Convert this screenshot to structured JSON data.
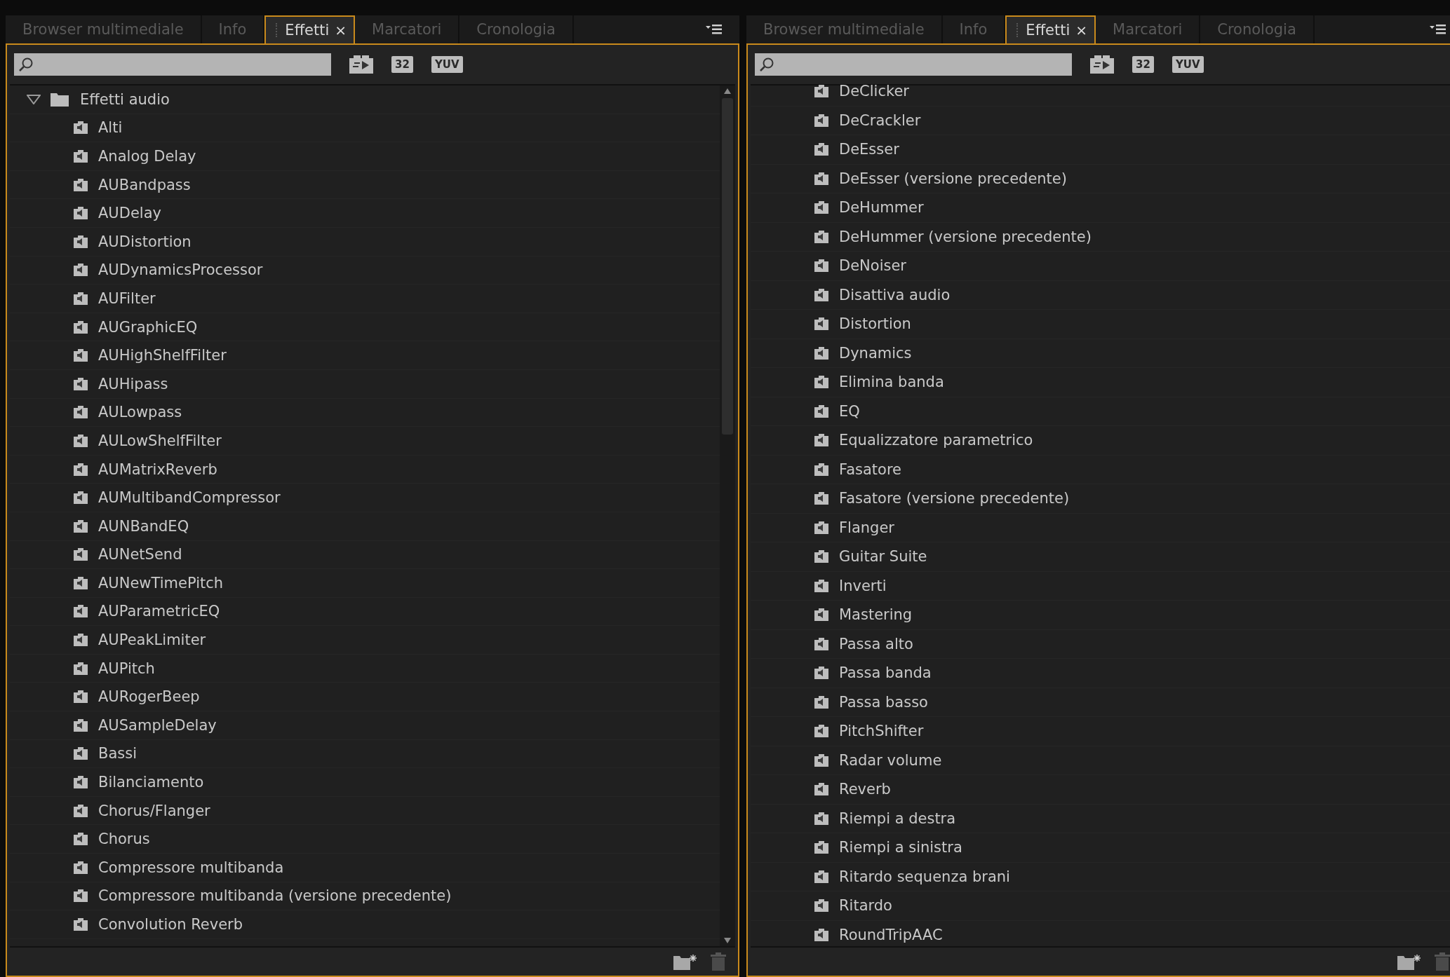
{
  "panels": [
    {
      "tabs": [
        {
          "label": "Browser multimediale",
          "selected": false
        },
        {
          "label": "Info",
          "selected": false
        },
        {
          "label": "Effetti",
          "selected": true,
          "close": "×"
        },
        {
          "label": "Marcatori",
          "selected": false
        },
        {
          "label": "Cronologia",
          "selected": false
        }
      ],
      "filters": [
        {
          "kind": "accelerated"
        },
        {
          "kind": "text",
          "label": "32"
        },
        {
          "kind": "text",
          "label": "YUV"
        }
      ],
      "tree": [
        {
          "label": "Effetti audio",
          "kind": "folder",
          "expanded": true,
          "children": [
            {
              "label": "Alti"
            },
            {
              "label": "Analog Delay"
            },
            {
              "label": "AUBandpass"
            },
            {
              "label": "AUDelay"
            },
            {
              "label": "AUDistortion"
            },
            {
              "label": "AUDynamicsProcessor"
            },
            {
              "label": "AUFilter"
            },
            {
              "label": "AUGraphicEQ"
            },
            {
              "label": "AUHighShelfFilter"
            },
            {
              "label": "AUHipass"
            },
            {
              "label": "AULowpass"
            },
            {
              "label": "AULowShelfFilter"
            },
            {
              "label": "AUMatrixReverb"
            },
            {
              "label": "AUMultibandCompressor"
            },
            {
              "label": "AUNBandEQ"
            },
            {
              "label": "AUNetSend"
            },
            {
              "label": "AUNewTimePitch"
            },
            {
              "label": "AUParametricEQ"
            },
            {
              "label": "AUPeakLimiter"
            },
            {
              "label": "AUPitch"
            },
            {
              "label": "AURogerBeep"
            },
            {
              "label": "AUSampleDelay"
            },
            {
              "label": "Bassi"
            },
            {
              "label": "Bilanciamento"
            },
            {
              "label": "Chorus/Flanger"
            },
            {
              "label": "Chorus"
            },
            {
              "label": "Compressore multibanda"
            },
            {
              "label": "Compressore multibanda (versione precedente)"
            },
            {
              "label": "Convolution Reverb"
            }
          ]
        }
      ]
    },
    {
      "tabs": [
        {
          "label": "Browser multimediale",
          "selected": false
        },
        {
          "label": "Info",
          "selected": false
        },
        {
          "label": "Effetti",
          "selected": true,
          "close": "×"
        },
        {
          "label": "Marcatori",
          "selected": false
        },
        {
          "label": "Cronologia",
          "selected": false
        }
      ],
      "filters": [
        {
          "kind": "accelerated"
        },
        {
          "kind": "text",
          "label": "32"
        },
        {
          "kind": "text",
          "label": "YUV"
        }
      ],
      "tree": [
        {
          "label": "DeClicker"
        },
        {
          "label": "DeCrackler"
        },
        {
          "label": "DeEsser"
        },
        {
          "label": "DeEsser (versione precedente)"
        },
        {
          "label": "DeHummer"
        },
        {
          "label": "DeHummer (versione precedente)"
        },
        {
          "label": "DeNoiser"
        },
        {
          "label": "Disattiva audio"
        },
        {
          "label": "Distortion"
        },
        {
          "label": "Dynamics"
        },
        {
          "label": "Elimina banda"
        },
        {
          "label": "EQ"
        },
        {
          "label": "Equalizzatore parametrico"
        },
        {
          "label": "Fasatore"
        },
        {
          "label": "Fasatore (versione precedente)"
        },
        {
          "label": "Flanger"
        },
        {
          "label": "Guitar Suite"
        },
        {
          "label": "Inverti"
        },
        {
          "label": "Mastering"
        },
        {
          "label": "Passa alto"
        },
        {
          "label": "Passa banda"
        },
        {
          "label": "Passa basso"
        },
        {
          "label": "PitchShifter"
        },
        {
          "label": "Radar volume"
        },
        {
          "label": "Reverb"
        },
        {
          "label": "Riempi a destra"
        },
        {
          "label": "Riempi a sinistra"
        },
        {
          "label": "Ritardo sequenza brani"
        },
        {
          "label": "Ritardo"
        },
        {
          "label": "RoundTripAAC"
        }
      ]
    }
  ]
}
